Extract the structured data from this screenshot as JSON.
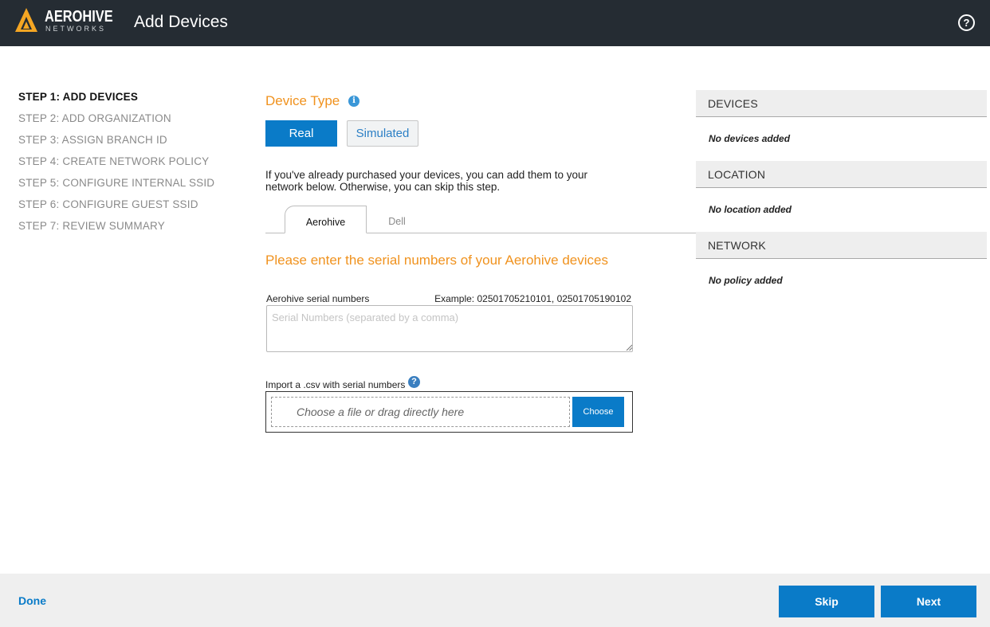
{
  "header": {
    "brand_name": "AEROHIVE",
    "brand_sub": "NETWORKS",
    "title": "Add Devices",
    "help_glyph": "?",
    "help_icon": "question-circle-icon",
    "logo_color": "#f5a623"
  },
  "steps": [
    {
      "label": "STEP 1: ADD DEVICES",
      "active": true
    },
    {
      "label": "STEP 2: ADD ORGANIZATION"
    },
    {
      "label": "STEP 3: ASSIGN BRANCH ID"
    },
    {
      "label": "STEP 4: CREATE NETWORK POLICY"
    },
    {
      "label": "STEP 5: CONFIGURE INTERNAL SSID"
    },
    {
      "label": "STEP 6: CONFIGURE GUEST SSID"
    },
    {
      "label": "STEP 7: REVIEW SUMMARY"
    }
  ],
  "device_type": {
    "heading": "Device Type",
    "info_glyph": "i",
    "options": {
      "real": "Real",
      "simulated": "Simulated"
    },
    "selected": "Real"
  },
  "intro_text": "If you've already purchased your devices, you can add them to your network below. Otherwise, you can skip this step.",
  "tabs": {
    "aerohive": "Aerohive",
    "dell": "Dell",
    "selected": "Aerohive"
  },
  "prompt": "Please enter the serial numbers of your Aerohive devices",
  "serial": {
    "label": "Aerohive serial numbers",
    "example": "Example: 02501705210101, 02501705190102",
    "placeholder": "Serial Numbers (separated by a comma)",
    "value": ""
  },
  "import": {
    "label": "Import a .csv with serial numbers",
    "help_glyph": "?",
    "dropzone_text": "Choose a file or drag directly here",
    "choose_label": "Choose"
  },
  "summary": {
    "devices": {
      "heading": "DEVICES",
      "empty": "No devices added"
    },
    "location": {
      "heading": "LOCATION",
      "empty": "No location added"
    },
    "network": {
      "heading": "NETWORK",
      "empty": "No policy added"
    }
  },
  "footer": {
    "done": "Done",
    "skip": "Skip",
    "next": "Next"
  },
  "colors": {
    "accent": "#0a7bc8",
    "orange": "#f0921e",
    "topbar": "#252c33"
  }
}
